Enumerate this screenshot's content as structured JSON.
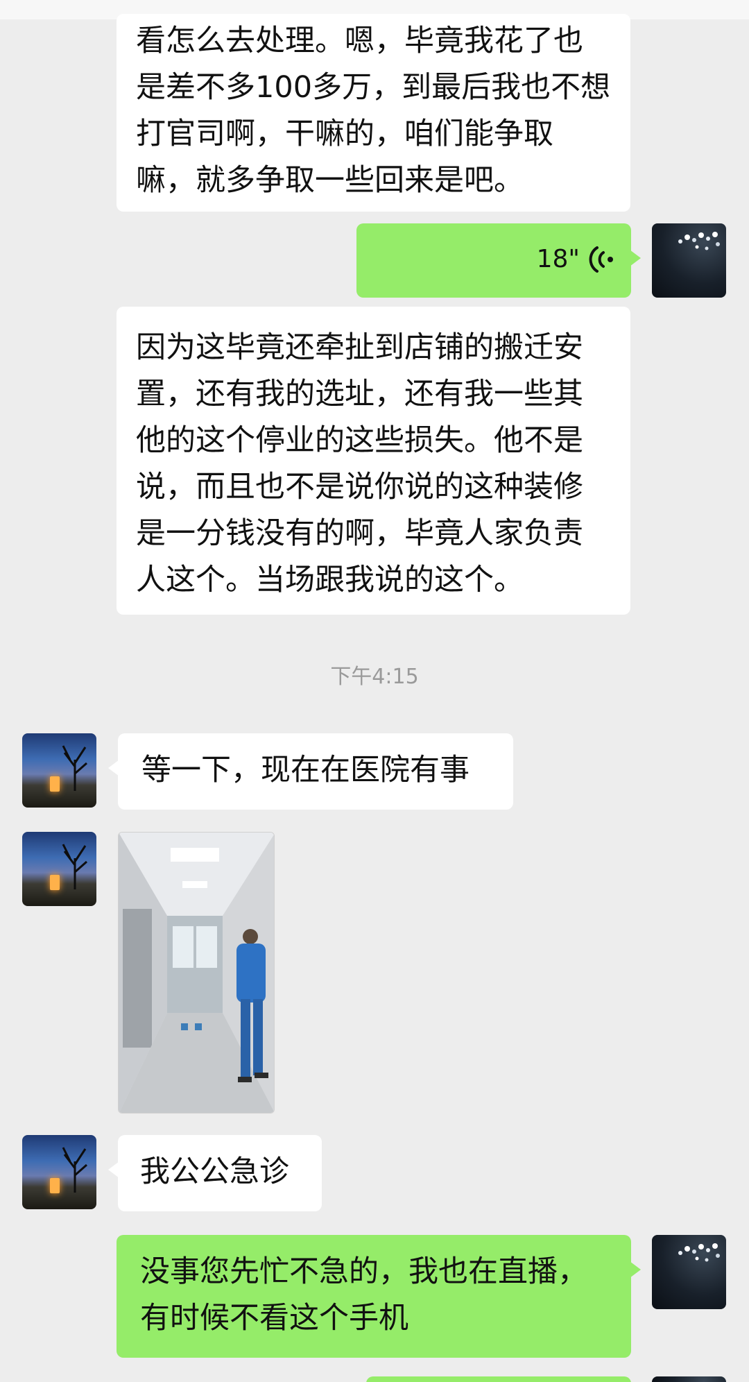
{
  "messages": {
    "m1": {
      "text": "看怎么去处理。嗯，毕竟我花了也是差不多100多万，到最后我也不想打官司啊，干嘛的，咱们能争取嘛，就多争取一些回来是吧。"
    },
    "m2": {
      "duration": "18\""
    },
    "m3": {
      "text": "因为这毕竟还牵扯到店铺的搬迁安置，还有我的选址，还有我一些其他的这个停业的这些损失。他不是说，而且也不是说你说的这种装修是一分钱没有的啊，毕竟人家负责人这个。当场跟我说的这个。"
    },
    "timestamp": "下午4:15",
    "m4": {
      "text": "等一下，现在在医院有事"
    },
    "m6": {
      "text": "我公公急诊"
    },
    "m7": {
      "text": "没事您先忙不急的，我也在直播，有时候不看这个手机"
    }
  },
  "icons": {
    "voice": "voice-waves-icon",
    "self_avatar": "self-avatar-dark-crystals",
    "contact_avatar": "contact-avatar-night-scene"
  },
  "colors": {
    "background": "#ededed",
    "outgoing_bubble": "#95ec69",
    "incoming_bubble": "#ffffff",
    "timestamp": "#9a9a9a"
  }
}
